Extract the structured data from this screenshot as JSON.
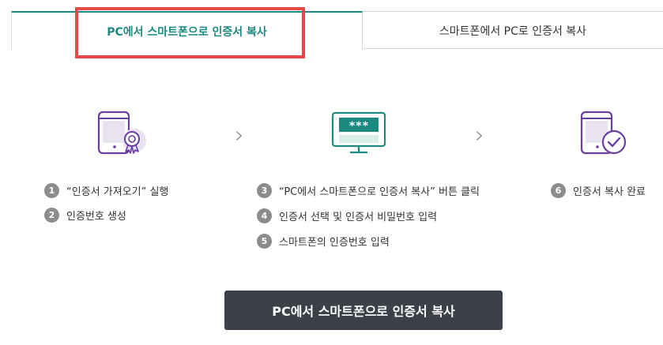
{
  "tabs": [
    {
      "label": "PC에서 스마트폰으로 인증서 복사",
      "active": true
    },
    {
      "label": "스마트폰에서 PC로 인증서 복사",
      "active": false
    }
  ],
  "steps": {
    "group1": [
      {
        "num": "1",
        "text": "“인증서 가져오기” 실행"
      },
      {
        "num": "2",
        "text": "인증번호 생성"
      }
    ],
    "group2": [
      {
        "num": "3",
        "text": "“PC에서 스마트폰으로 인증서 복사” 버튼 클릭"
      },
      {
        "num": "4",
        "text": "인증서 선택 및 인증서 비밀번호 입력"
      },
      {
        "num": "5",
        "text": "스마트폰의 인증번호 입력"
      }
    ],
    "group3": [
      {
        "num": "6",
        "text": "인증서 복사 완료"
      }
    ]
  },
  "icons": {
    "phone_certificate": "phone-certificate-icon",
    "monitor_password": "monitor-password-icon",
    "phone_check": "phone-check-icon",
    "arrow": "chevron-right-icon",
    "monitor_text": "***"
  },
  "colors": {
    "accent": "#1a8a7f",
    "purple": "#6b3fa0",
    "button_bg": "#3c4149",
    "highlight": "#e8474b"
  },
  "main_button": {
    "label": "PC에서 스마트폰으로 인증서 복사"
  }
}
